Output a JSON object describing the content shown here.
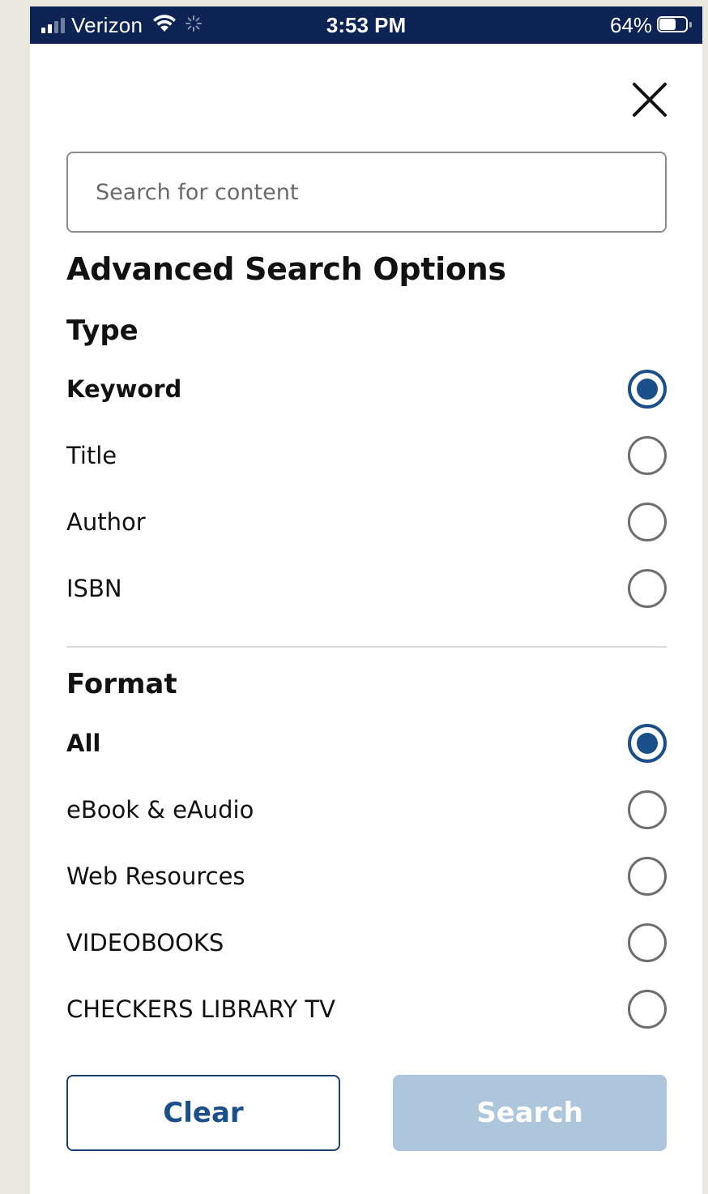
{
  "status_bar": {
    "carrier": "Verizon",
    "time": "3:53 PM",
    "battery": "64%"
  },
  "search": {
    "placeholder": "Search for content",
    "value": ""
  },
  "advanced": {
    "title": "Advanced Search Options"
  },
  "type_section": {
    "heading": "Type",
    "options": [
      {
        "label": "Keyword",
        "selected": true
      },
      {
        "label": "Title",
        "selected": false
      },
      {
        "label": "Author",
        "selected": false
      },
      {
        "label": "ISBN",
        "selected": false
      }
    ]
  },
  "format_section": {
    "heading": "Format",
    "options": [
      {
        "label": "All",
        "selected": true
      },
      {
        "label": "eBook & eAudio",
        "selected": false
      },
      {
        "label": "Web Resources",
        "selected": false
      },
      {
        "label": "VIDEOBOOKS",
        "selected": false
      },
      {
        "label": "CHECKERS LIBRARY TV",
        "selected": false
      }
    ]
  },
  "actions": {
    "clear_label": "Clear",
    "search_label": "Search"
  },
  "colors": {
    "status_bar_bg": "#0c2354",
    "accent": "#1b4f89",
    "search_button_disabled": "#adc6db"
  },
  "icons": {
    "close": "close-icon",
    "wifi": "wifi-icon",
    "signal": "signal-icon",
    "battery": "battery-icon",
    "activity": "activity-spinner-icon"
  }
}
